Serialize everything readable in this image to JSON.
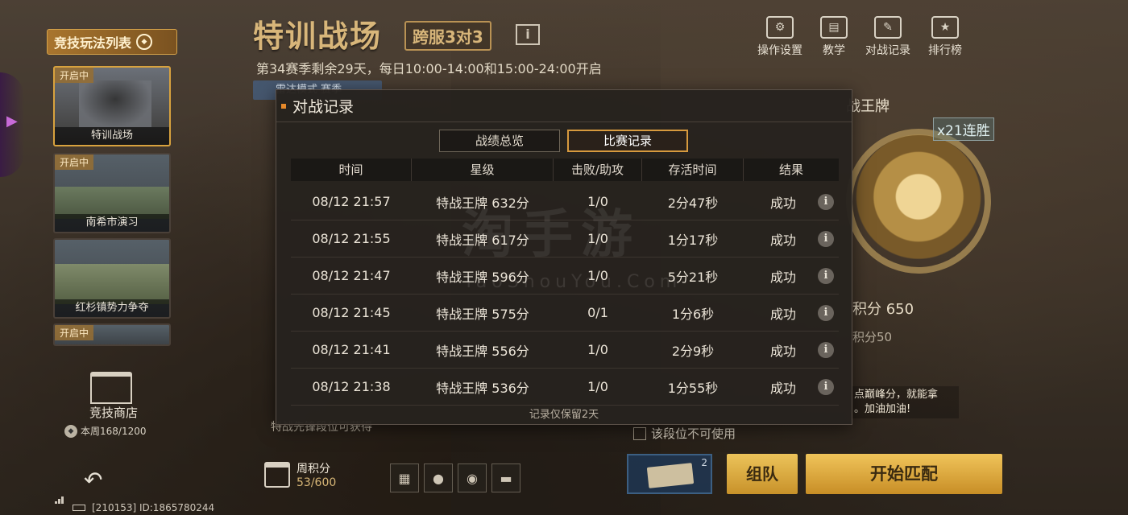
{
  "left_panel": {
    "header": "竞技玩法列表",
    "modes": [
      {
        "tag": "开启中",
        "name": "特训战场"
      },
      {
        "tag": "开启中",
        "name": "南希市演习"
      },
      {
        "tag": "",
        "name": "红杉镇势力争夺"
      },
      {
        "tag": "开启中",
        "name": ""
      }
    ],
    "shop_label": "竞技商店",
    "shop_count": "本周168/1200",
    "status": "[210153] ID:1865780244"
  },
  "title": {
    "main": "特训战场",
    "badge": "跨服3对3",
    "info_icon": "i",
    "season": "第34赛季剩余29天，每日10:00-14:00和15:00-24:00开启",
    "mode_chip": "雷达模式 赛季"
  },
  "top_menu": [
    {
      "label": "操作设置",
      "icon": "settings-icon"
    },
    {
      "label": "教学",
      "icon": "book-icon"
    },
    {
      "label": "对战记录",
      "icon": "record-icon"
    },
    {
      "label": "排行榜",
      "icon": "trophy-icon"
    }
  ],
  "right_panel": {
    "rank_name": "战王牌",
    "streak": "x21连胜",
    "score": "积分 650",
    "score2": "积分50",
    "tip": "点巅峰分，就能拿\n。加油加油!",
    "unusable": "该段位不可使用",
    "bottom_note": "特战先锋段位可获得"
  },
  "bottom_bar": {
    "week_label": "周积分",
    "week_value": "53/600",
    "ticket_count": "2",
    "team_button": "组队",
    "start_button": "开始匹配"
  },
  "modal": {
    "title": "对战记录",
    "tabs": [
      "战绩总览",
      "比赛记录"
    ],
    "active_tab": 1,
    "columns": [
      "时间",
      "星级",
      "击败/助攻",
      "存活时间",
      "结果"
    ],
    "rows": [
      {
        "time": "08/12 21:57",
        "tier": "特战王牌 632分",
        "kd": "1/0",
        "survival": "2分47秒",
        "result": "成功"
      },
      {
        "time": "08/12 21:55",
        "tier": "特战王牌 617分",
        "kd": "1/0",
        "survival": "1分17秒",
        "result": "成功"
      },
      {
        "time": "08/12 21:47",
        "tier": "特战王牌 596分",
        "kd": "1/0",
        "survival": "5分21秒",
        "result": "成功"
      },
      {
        "time": "08/12 21:45",
        "tier": "特战王牌 575分",
        "kd": "0/1",
        "survival": "1分6秒",
        "result": "成功"
      },
      {
        "time": "08/12 21:41",
        "tier": "特战王牌 556分",
        "kd": "1/0",
        "survival": "2分9秒",
        "result": "成功"
      },
      {
        "time": "08/12 21:38",
        "tier": "特战王牌 536分",
        "kd": "1/0",
        "survival": "1分55秒",
        "result": "成功"
      }
    ],
    "footer": "记录仅保留2天"
  },
  "watermark": {
    "main": "淘手游",
    "sub": "TaoShouYou.Com"
  },
  "colors": {
    "accent": "#d79a3e",
    "success": "#7ec07a",
    "title_gold": "#d8b67a"
  }
}
